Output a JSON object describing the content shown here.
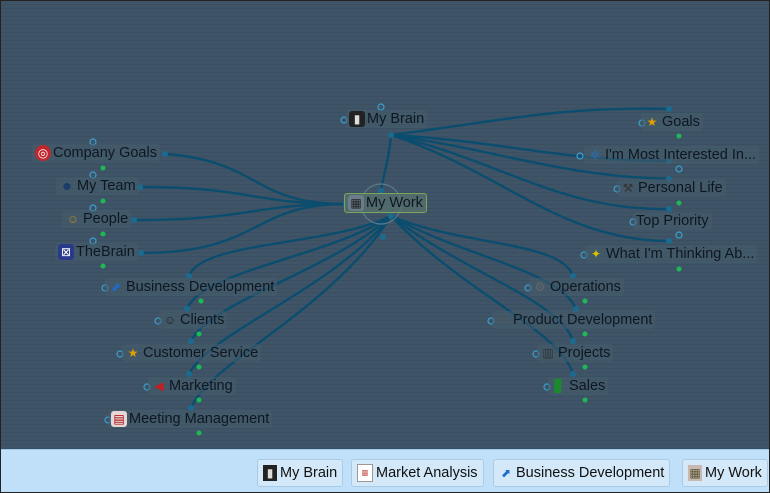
{
  "center": {
    "label": "My Work",
    "icon": "building-icon"
  },
  "parent": {
    "label": "My Brain",
    "icon": "phone-icon"
  },
  "jumps_left": [
    {
      "label": "Company Goals",
      "icon": "target-icon"
    },
    {
      "label": "My Team",
      "icon": "team-icon"
    },
    {
      "label": "People",
      "icon": "people-icon"
    },
    {
      "label": "TheBrain",
      "icon": "thebrain-logo-icon"
    }
  ],
  "siblings_right": [
    {
      "label": "Goals",
      "icon": "star-icon"
    },
    {
      "label": "I'm Most Interested In...",
      "icon": "molecule-icon"
    },
    {
      "label": "Personal Life",
      "icon": "hammer-icon"
    },
    {
      "label": "Top Priority",
      "icon": ""
    },
    {
      "label": "What I'm Thinking Ab...",
      "icon": "lightbulb-icon"
    }
  ],
  "children_left": [
    {
      "label": "Business Development",
      "icon": "chart-icon"
    },
    {
      "label": "Clients",
      "icon": "people-icon"
    },
    {
      "label": "Customer Service",
      "icon": "star-icon"
    },
    {
      "label": "Marketing",
      "icon": "megaphone-icon"
    },
    {
      "label": "Meeting Management",
      "icon": "calendar-icon"
    }
  ],
  "children_right": [
    {
      "label": "Operations",
      "icon": "gear-icon"
    },
    {
      "label": "Product Development",
      "icon": "tools-icon"
    },
    {
      "label": "Projects",
      "icon": "clipboard-icon"
    },
    {
      "label": "Sales",
      "icon": "bar-chart-icon"
    }
  ],
  "pins": [
    {
      "label": "My Brain",
      "icon": "phone-icon"
    },
    {
      "label": "Market Analysis",
      "icon": "document-icon"
    },
    {
      "label": "Business Development",
      "icon": "chart-icon"
    },
    {
      "label": "My Work",
      "icon": "building-icon"
    }
  ],
  "colors": {
    "link": "#0b4d6e",
    "dot_green": "#1db954",
    "dot_blue_ring": "#3aa0d0",
    "pinbar": "#bfe0f8"
  }
}
